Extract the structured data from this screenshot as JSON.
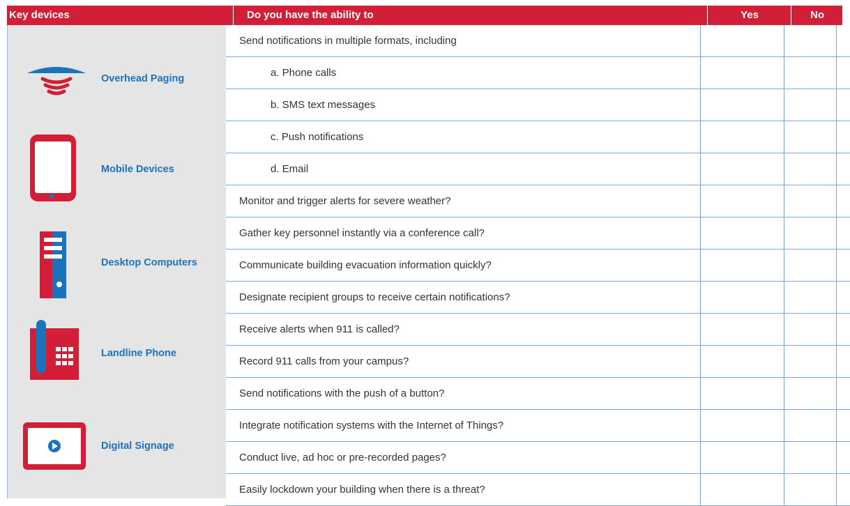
{
  "header": {
    "devices": "Key devices",
    "question": "Do you have the ability to",
    "yes": "Yes",
    "no": "No"
  },
  "colors": {
    "header_red": "#d21f37",
    "device_blue": "#1c73bd",
    "icon_red": "#d21f37",
    "panel_gray": "#e5e5e5",
    "grid_blue": "#7ca5d8"
  },
  "devices": [
    {
      "label": "Overhead Paging",
      "icon": "overhead-paging-icon"
    },
    {
      "label": "Mobile Devices",
      "icon": "mobile-device-icon"
    },
    {
      "label": "Desktop Computers",
      "icon": "desktop-computer-icon"
    },
    {
      "label": "Landline Phone",
      "icon": "landline-phone-icon"
    },
    {
      "label": "Digital Signage",
      "icon": "digital-signage-icon"
    }
  ],
  "rows": [
    {
      "text": "Send notifications in multiple formats, including",
      "sub": false
    },
    {
      "text": "a. Phone calls",
      "sub": true
    },
    {
      "text": "b. SMS text messages",
      "sub": true
    },
    {
      "text": "c. Push notifications",
      "sub": true
    },
    {
      "text": "d. Email",
      "sub": true
    },
    {
      "text": "Monitor and trigger alerts for severe weather?",
      "sub": false
    },
    {
      "text": "Gather key personnel instantly via a conference call?",
      "sub": false
    },
    {
      "text": "Communicate building evacuation information quickly?",
      "sub": false
    },
    {
      "text": "Designate recipient groups to receive certain notifications?",
      "sub": false
    },
    {
      "text": "Receive alerts when 911 is called?",
      "sub": false
    },
    {
      "text": "Record 911 calls from your campus?",
      "sub": false
    },
    {
      "text": "Send notifications with the push of a button?",
      "sub": false
    },
    {
      "text": "Integrate notification systems with the Internet of Things?",
      "sub": false
    },
    {
      "text": "Conduct live, ad hoc or pre-recorded pages?",
      "sub": false
    },
    {
      "text": "Easily lockdown your building when there is a threat?",
      "sub": false
    }
  ]
}
